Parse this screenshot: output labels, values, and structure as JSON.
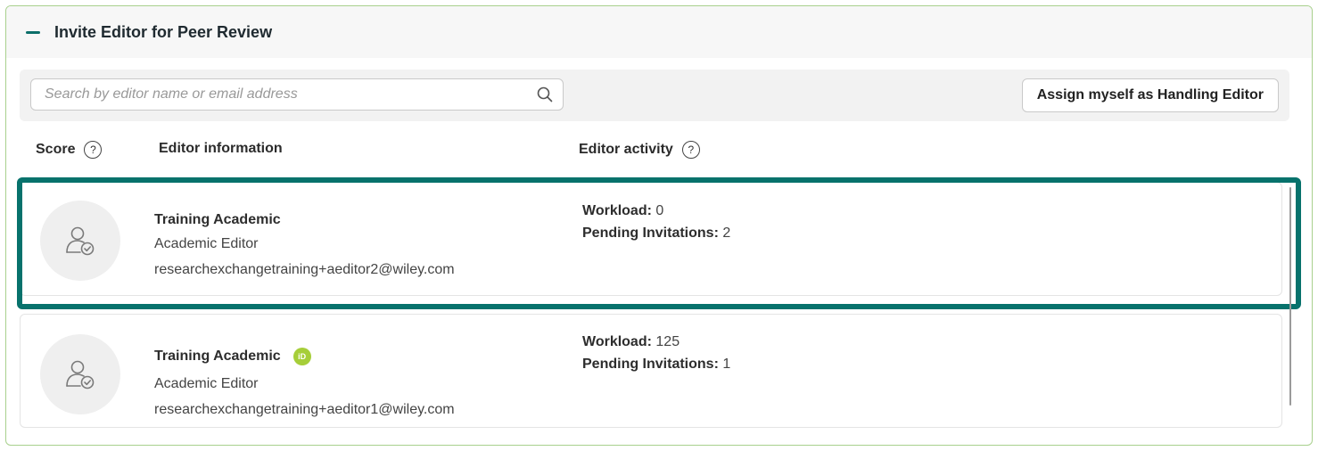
{
  "panel": {
    "title": "Invite Editor for Peer Review"
  },
  "search": {
    "placeholder": "Search by editor name or email address",
    "value": ""
  },
  "toolbar": {
    "assign_label": "Assign myself as Handling Editor"
  },
  "columns": {
    "score": "Score",
    "editor_information": "Editor information",
    "editor_activity": "Editor activity"
  },
  "editors": [
    {
      "name": "Training Academic",
      "role": "Academic Editor",
      "email": "researchexchangetraining+aeditor2@wiley.com",
      "workload_label": "Workload:",
      "workload": "0",
      "pending_label": "Pending Invitations:",
      "pending": "2",
      "orcid": false
    },
    {
      "name": "Training Academic",
      "role": "Academic Editor",
      "email": "researchexchangetraining+aeditor1@wiley.com",
      "workload_label": "Workload:",
      "workload": "125",
      "pending_label": "Pending Invitations:",
      "pending": "1",
      "orcid": true,
      "orcid_label": "iD"
    }
  ],
  "colors": {
    "accent": "#07726c",
    "panel_border": "#a8d08d",
    "orcid": "#a6ce39"
  },
  "icons": {
    "collapse": "minus-icon",
    "search": "search-icon",
    "help": "help-circle-icon",
    "avatar": "user-check-icon",
    "orcid": "orcid-icon"
  }
}
